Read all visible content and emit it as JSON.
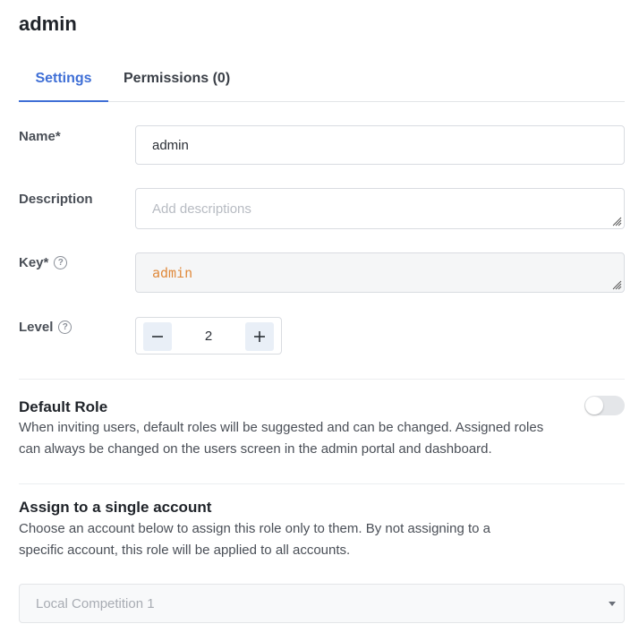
{
  "page": {
    "title": "admin"
  },
  "tabs": [
    {
      "label": "Settings",
      "active": true
    },
    {
      "label": "Permissions (0)",
      "active": false
    }
  ],
  "form": {
    "name": {
      "label": "Name*",
      "value": "admin"
    },
    "description": {
      "label": "Description",
      "placeholder": "Add descriptions",
      "value": ""
    },
    "key": {
      "label": "Key*",
      "value": "admin",
      "help_icon": "question-circle-icon"
    },
    "level": {
      "label": "Level",
      "value": "2",
      "help_icon": "question-circle-icon",
      "decrement_icon": "minus-icon",
      "increment_icon": "plus-icon"
    }
  },
  "default_role": {
    "title": "Default Role",
    "description": "When inviting users, default roles will be suggested and can be changed. Assigned roles can always be changed on the users screen in the admin portal and dashboard.",
    "enabled": false
  },
  "assign_account": {
    "title": "Assign to a single account",
    "description": "Choose an account below to assign this role only to them. By not assigning to a specific account, this role will be applied to all accounts.",
    "select_value": "Local Competition 1"
  },
  "colors": {
    "accent": "#3f6fd6",
    "key_text": "#e08a3c",
    "stepper_button_bg": "#e9eff7",
    "toggle_off": "#e4e6e9"
  }
}
